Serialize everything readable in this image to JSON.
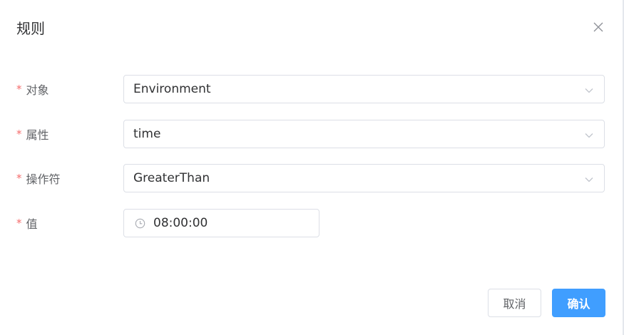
{
  "dialog": {
    "title": "规则",
    "close_icon": "close-icon"
  },
  "form": {
    "required_mark": "*",
    "fields": [
      {
        "label": "对象",
        "value": "Environment",
        "type": "select"
      },
      {
        "label": "属性",
        "value": "time",
        "type": "select"
      },
      {
        "label": "操作符",
        "value": "GreaterThan",
        "type": "select"
      },
      {
        "label": "值",
        "value": "08:00:00",
        "type": "time-picker",
        "icon": "clock-icon"
      }
    ]
  },
  "footer": {
    "cancel_label": "取消",
    "confirm_label": "确认"
  },
  "colors": {
    "primary": "#409eff",
    "required": "#f56c6c",
    "border": "#dcdfe6",
    "text": "#303133",
    "label": "#606266"
  }
}
